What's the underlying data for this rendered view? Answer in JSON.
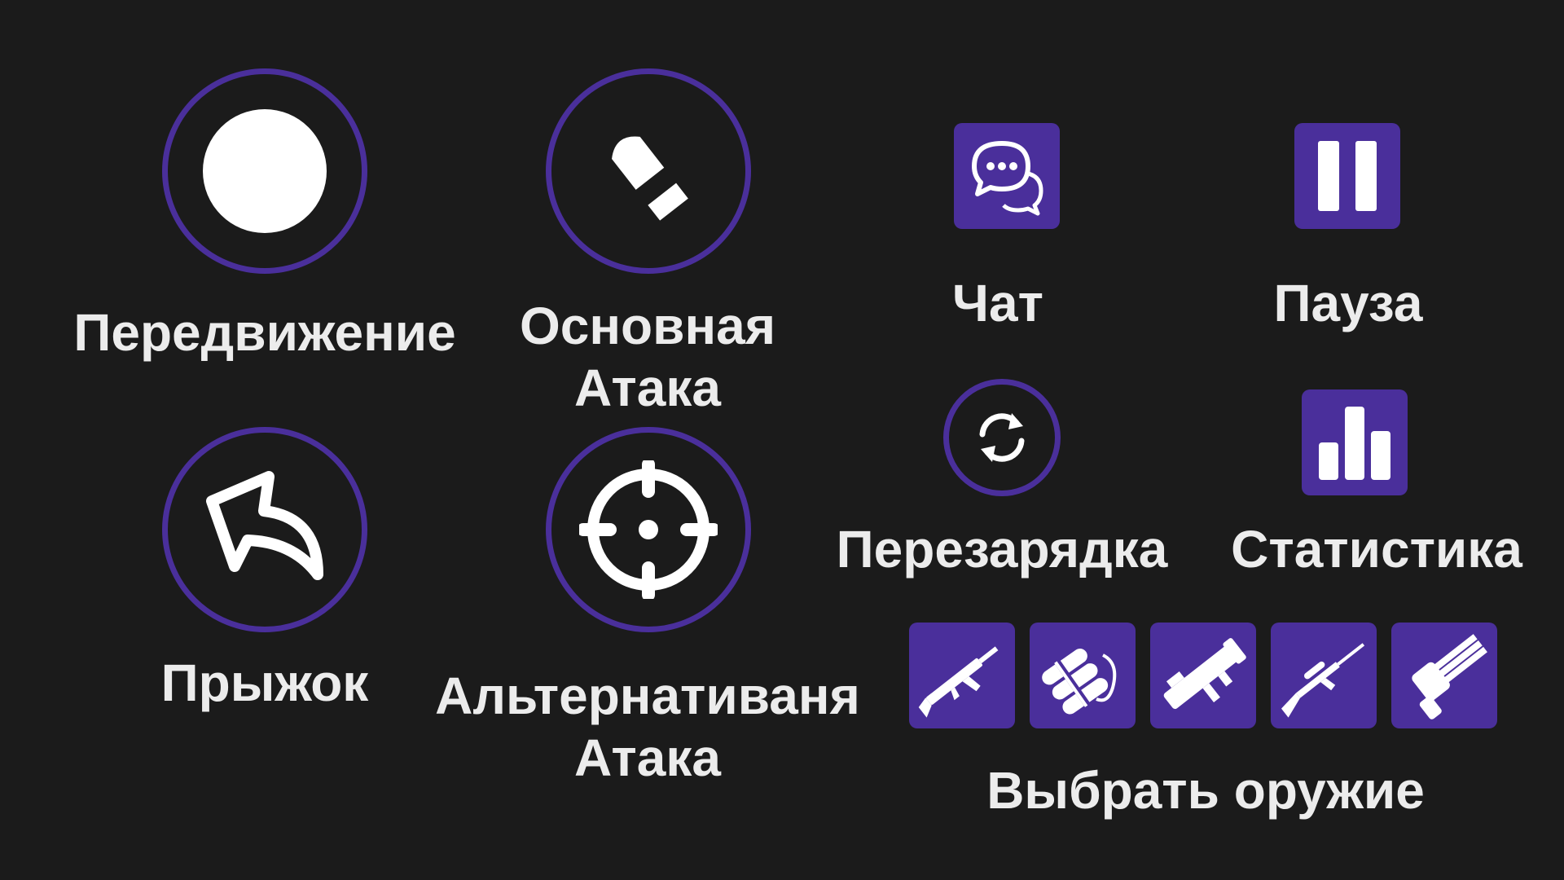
{
  "colors": {
    "background": "#1b1b1b",
    "accent": "#4a2f9b",
    "icon": "#ffffff",
    "text": "#ececec"
  },
  "controls": {
    "movement": {
      "label": "Передвижение",
      "icon": "joystick-icon"
    },
    "primary_attack": {
      "label_line1": "Основная",
      "label_line2": "Атака",
      "icon": "bullet-icon"
    },
    "jump": {
      "label": "Прыжок",
      "icon": "arrow-back-icon"
    },
    "alt_attack": {
      "label_line1": "Альтернативаня",
      "label_line2": "Атака",
      "icon": "crosshair-icon"
    },
    "chat": {
      "label": "Чат",
      "icon": "chat-icon"
    },
    "pause": {
      "label": "Пауза",
      "icon": "pause-icon"
    },
    "reload": {
      "label": "Перезарядка",
      "icon": "reload-icon"
    },
    "stats": {
      "label": "Статистика",
      "icon": "bar-chart-icon"
    }
  },
  "weapons": {
    "label": "Выбрать оружие",
    "items": [
      "assault-rifle-icon",
      "dynamite-icon",
      "rocket-launcher-icon",
      "sniper-rifle-icon",
      "minigun-icon"
    ]
  }
}
